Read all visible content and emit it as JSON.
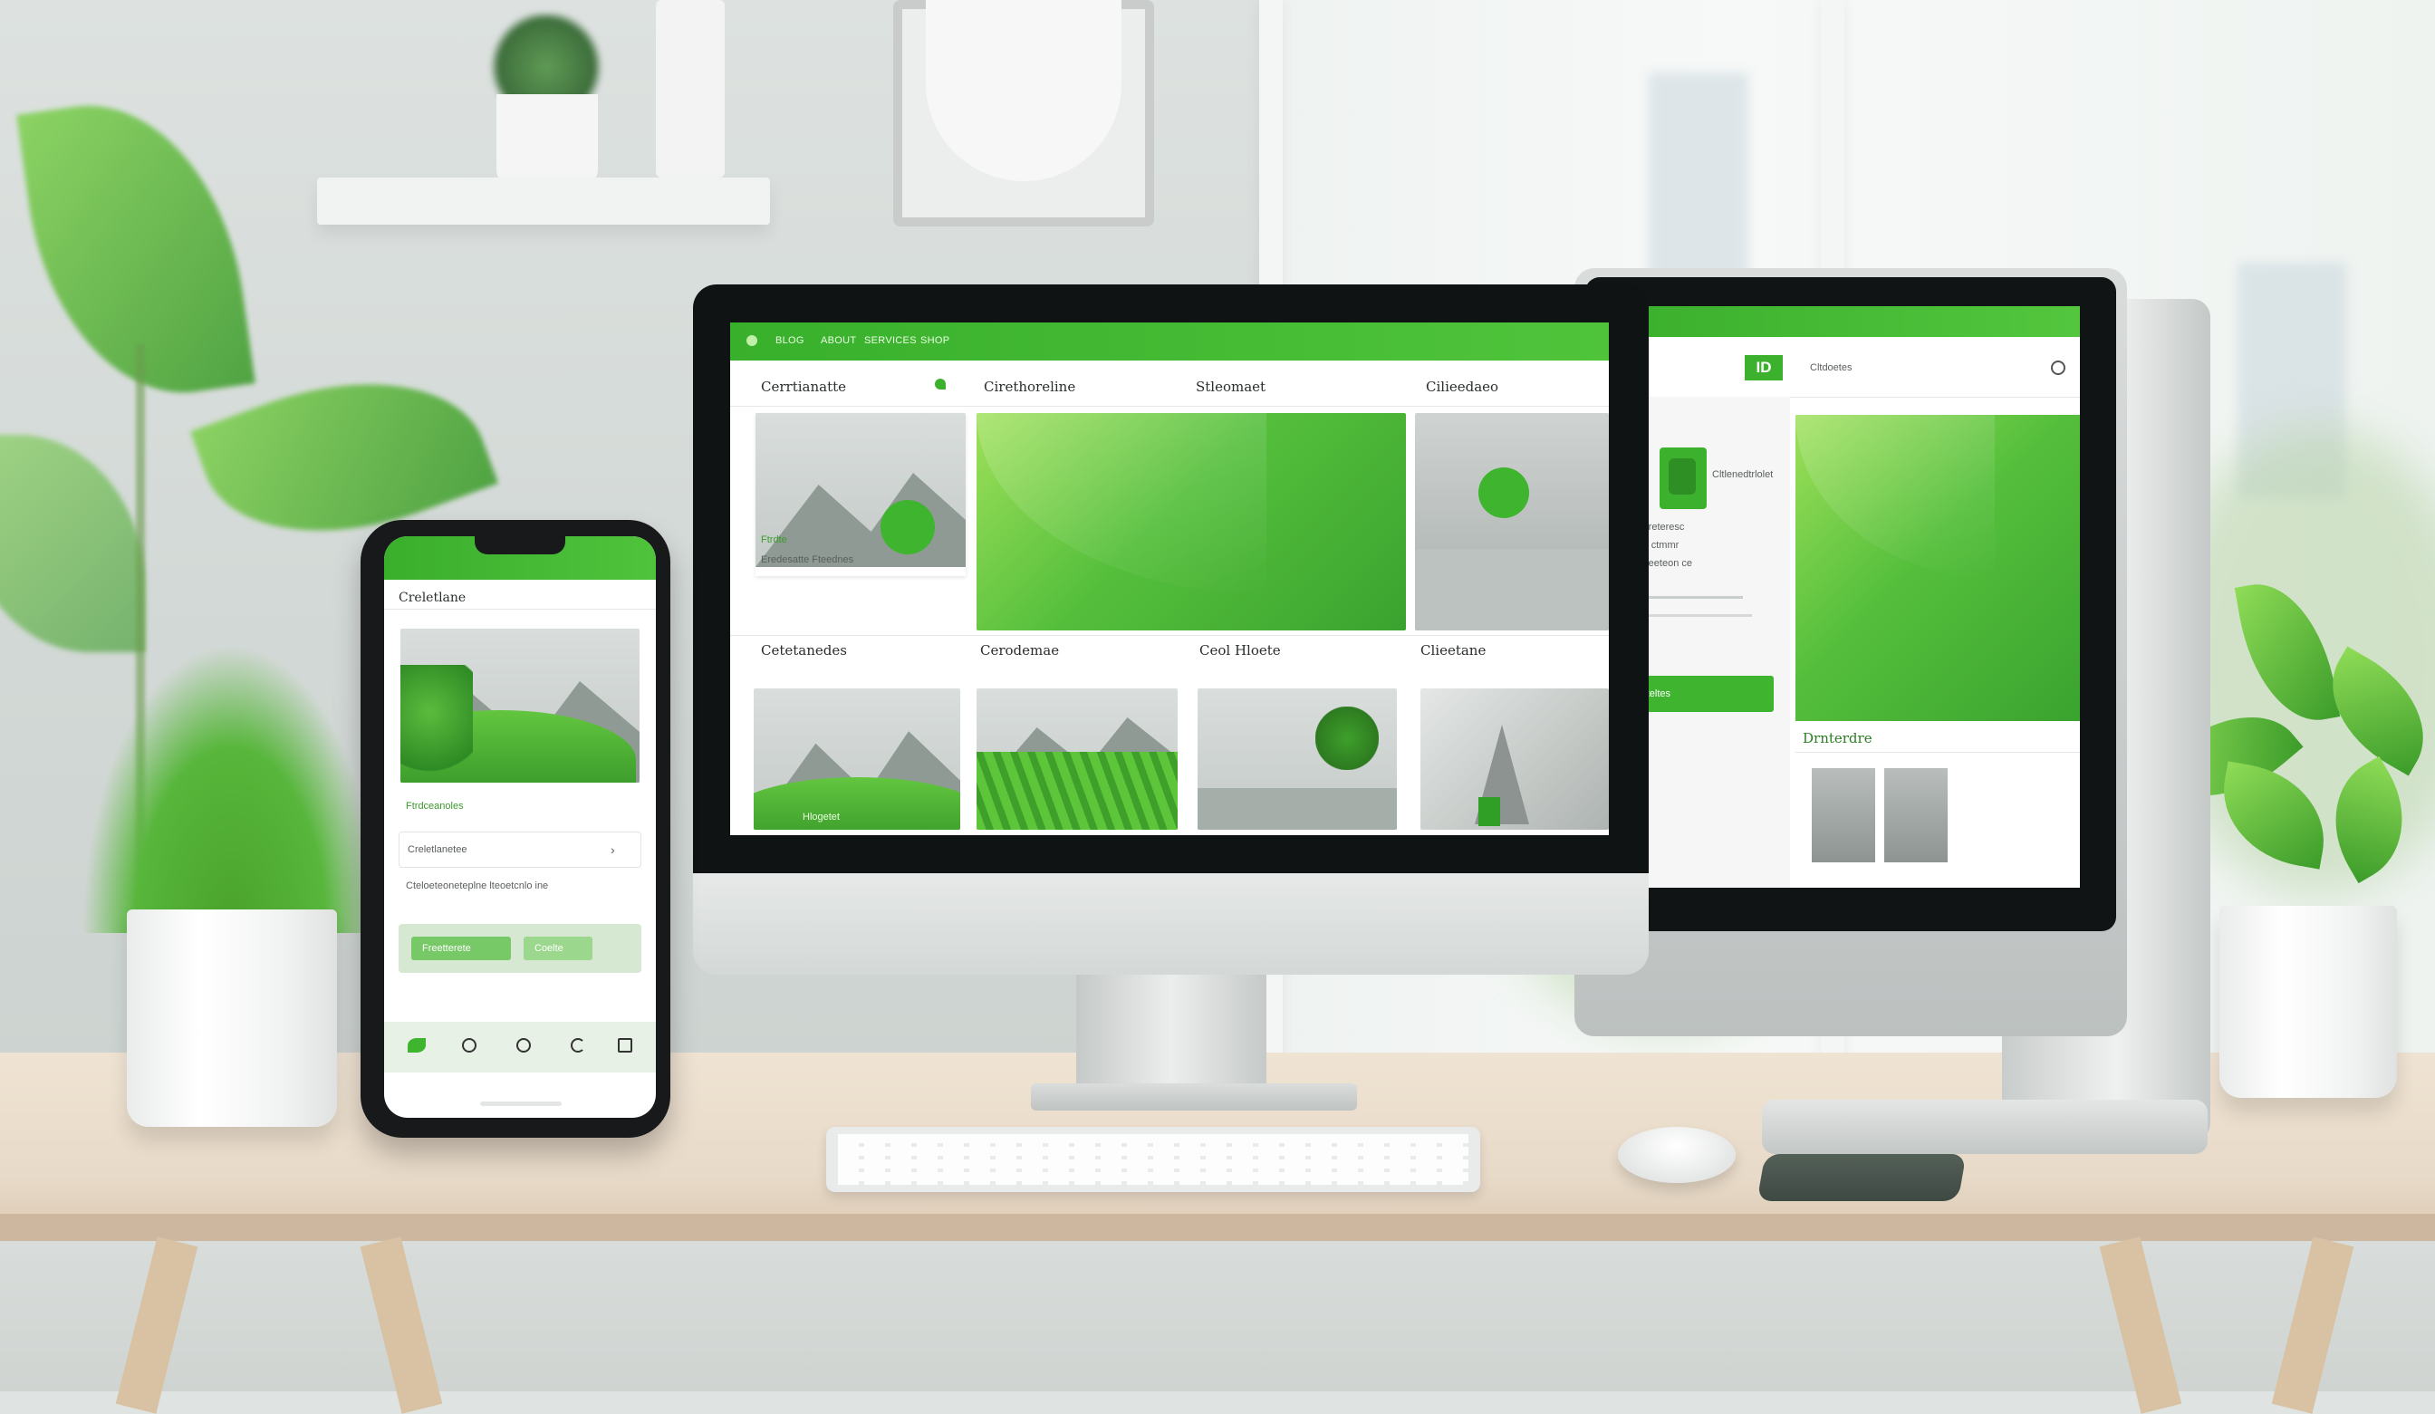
{
  "scene": {
    "description_colors": {
      "accent": "#4fc43b",
      "accent_dark": "#2f8f26",
      "wall": "#dde2e0",
      "desk": "#ece0cf"
    }
  },
  "imac": {
    "nav": {
      "links": [
        "BLOG",
        "ABOUT",
        "SERVICES",
        "SHOP"
      ]
    },
    "sections_row1": [
      "Cerrtianatte",
      "Cirethoreline",
      "Stleomaet",
      "Cilieedaeo"
    ],
    "sections_row2": [
      "Cetetanedes",
      "Cerodemae",
      "Ceol Hloete",
      "Clieetane"
    ],
    "tile_caption": "Ftrdte",
    "tile_sub": "Eredesatte  Fteednes",
    "mountain_caption": "Hlogetet"
  },
  "monitor2": {
    "nav": {
      "logo": "ID",
      "link": "Cltdoetes"
    },
    "profile_lines": [
      "Cltlenedtrlolet",
      "Cltdoreteresc",
      "Cltdo ctmmr",
      "Cltdoeeteon ce"
    ],
    "button": "Creteltes",
    "section_title": "Drnterdre"
  },
  "phone": {
    "title": "Creletlane",
    "link": "Ftrdceanoles",
    "field_label": "Creletlanetee",
    "body": "Cteloeteoneteplne lteoetcnlo ine",
    "button_primary": "Freetterete",
    "button_secondary": "Coelte",
    "nav_icons": [
      "leaf-icon",
      "circle-icon",
      "circle-icon",
      "refresh-icon",
      "square-icon"
    ]
  }
}
